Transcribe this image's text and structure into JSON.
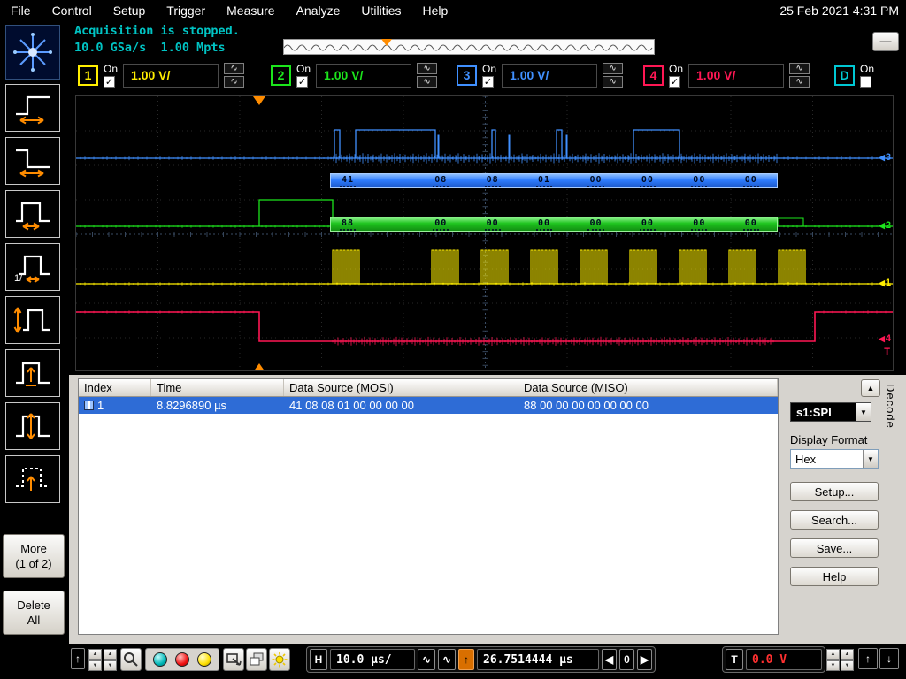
{
  "colors": {
    "ch1": "#ffee00",
    "ch2": "#1ce51c",
    "ch3": "#4090ff",
    "ch4": "#ff1754",
    "digital": "#00c8d4",
    "accent": "#ff8c00",
    "selection": "#2e6cd6",
    "mosi_bus": "#2f7dff",
    "miso_bus": "#1fc41f",
    "status_text": "#00c4c4"
  },
  "menu": {
    "items": [
      "File",
      "Control",
      "Setup",
      "Trigger",
      "Measure",
      "Analyze",
      "Utilities",
      "Help"
    ],
    "datetime": "25 Feb 2021 4:31 PM"
  },
  "status": {
    "line1": "Acquisition is stopped.",
    "line2": "10.0 GSa/s  1.00 Mpts"
  },
  "channels": [
    {
      "id": "1",
      "on": "On",
      "scale": "1.00 V/"
    },
    {
      "id": "2",
      "on": "On",
      "scale": "1.00 V/"
    },
    {
      "id": "3",
      "on": "On",
      "scale": "1.00 V/"
    },
    {
      "id": "4",
      "on": "On",
      "scale": "1.00 V/"
    },
    {
      "id": "D",
      "on": "On"
    }
  ],
  "sidebar": {
    "icons": [
      "scope-logo",
      "rising-edge",
      "falling-edge",
      "pulse-width",
      "glitch",
      "amplitude-pulse",
      "runt-pulse",
      "window-pulse",
      "timeout-pulse"
    ],
    "more_line1": "More",
    "more_line2": "(1 of 2)",
    "delete_line1": "Delete",
    "delete_line2": "All"
  },
  "waveform": {
    "mosi_bus": [
      "41",
      "08",
      "08",
      "01",
      "00",
      "00",
      "00",
      "00"
    ],
    "miso_bus": [
      "88",
      "00",
      "00",
      "00",
      "00",
      "00",
      "00",
      "00"
    ],
    "marker_ch3": "3",
    "marker_ch2": "2",
    "marker_ch1": "1",
    "marker_ch4": "4",
    "trigger_marker": "T"
  },
  "table": {
    "columns": [
      "Index",
      "Time",
      "Data Source (MOSI)",
      "Data Source (MISO)"
    ],
    "rows": [
      {
        "index": "1",
        "time": "8.8296890 µs",
        "mosi": "41 08 08 01 00 00 00 00",
        "miso": "88 00 00 00 00 00 00 00"
      }
    ]
  },
  "decode_panel": {
    "title": "Decode",
    "source": "s1:SPI",
    "display_format_label": "Display Format",
    "format": "Hex",
    "setup": "Setup...",
    "search": "Search...",
    "save": "Save...",
    "help": "Help"
  },
  "bottom": {
    "h": "H",
    "timebase": "10.0 µs/",
    "position": "26.7514444 µs",
    "zero": "0",
    "t": "T",
    "level": "0.0 V"
  },
  "icons": {
    "minimize": "—",
    "dropdown": "▼",
    "spin_up": "▲",
    "spin_down": "▼",
    "arrow_left": "◀",
    "arrow_right": "▶",
    "arrow_up": "↑",
    "arrow_down": "↓",
    "sine": "∿",
    "check": "✓",
    "panel_up": "▲"
  }
}
